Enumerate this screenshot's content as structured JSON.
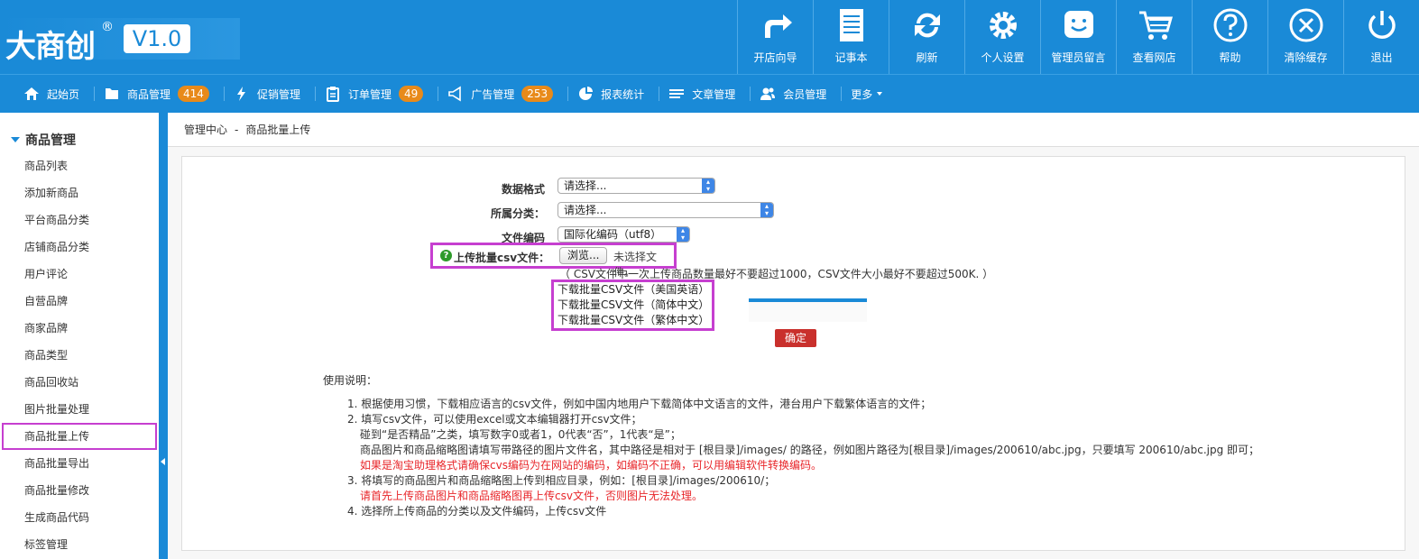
{
  "header": {
    "logo_text": "大商创",
    "logo_reg": "®",
    "version": "V1.0",
    "tools": [
      {
        "label": "开店向导",
        "icon": "share-arrow-icon"
      },
      {
        "label": "记事本",
        "icon": "notepad-icon"
      },
      {
        "label": "刷新",
        "icon": "refresh-icon"
      },
      {
        "label": "个人设置",
        "icon": "gear-icon"
      },
      {
        "label": "管理员留言",
        "icon": "smiley-message-icon"
      },
      {
        "label": "查看网店",
        "icon": "shopping-cart-icon"
      },
      {
        "label": "帮助",
        "icon": "help-icon"
      },
      {
        "label": "清除缓存",
        "icon": "close-circle-icon"
      },
      {
        "label": "退出",
        "icon": "power-icon"
      }
    ]
  },
  "nav": {
    "items": [
      {
        "label": "起始页",
        "icon": "home-icon",
        "badge": ""
      },
      {
        "label": "商品管理",
        "icon": "folder-icon",
        "badge": "414"
      },
      {
        "label": "促销管理",
        "icon": "lightning-icon",
        "badge": ""
      },
      {
        "label": "订单管理",
        "icon": "clipboard-icon",
        "badge": "49"
      },
      {
        "label": "广告管理",
        "icon": "megaphone-icon",
        "badge": "253"
      },
      {
        "label": "报表统计",
        "icon": "pie-chart-icon",
        "badge": ""
      },
      {
        "label": "文章管理",
        "icon": "list-icon",
        "badge": ""
      },
      {
        "label": "会员管理",
        "icon": "users-icon",
        "badge": ""
      },
      {
        "label": "更多",
        "icon": "caret-down-icon",
        "badge": ""
      }
    ]
  },
  "sidebar": {
    "heading": "商品管理",
    "items": [
      {
        "label": "商品列表"
      },
      {
        "label": "添加新商品"
      },
      {
        "label": "平台商品分类"
      },
      {
        "label": "店铺商品分类"
      },
      {
        "label": "用户评论"
      },
      {
        "label": "自营品牌"
      },
      {
        "label": "商家品牌"
      },
      {
        "label": "商品类型"
      },
      {
        "label": "商品回收站"
      },
      {
        "label": "图片批量处理"
      },
      {
        "label": "商品批量上传"
      },
      {
        "label": "商品批量导出"
      },
      {
        "label": "商品批量修改"
      },
      {
        "label": "生成商品代码"
      },
      {
        "label": "标签管理"
      }
    ],
    "active_label": "商品批量上传"
  },
  "breadcrumb": {
    "root": "管理中心",
    "separator": "-",
    "current": "商品批量上传"
  },
  "form": {
    "data_format_label": "数据格式",
    "data_format_value": "请选择...",
    "category_label": "所属分类：",
    "category_value": "请选择...",
    "encoding_label": "文件编码",
    "encoding_value": "国际化编码（utf8）",
    "upload_label": "上传批量csv文件：",
    "browse_label": "浏览...",
    "no_file_label": "未选择文件。",
    "note": "（ CSV文件中一次上传商品数量最好不要超过1000，CSV文件大小最好不要超过500K. ）",
    "downloads": [
      {
        "label": "下载批量CSV文件（美国英语）"
      },
      {
        "label": "下载批量CSV文件（简体中文）"
      },
      {
        "label": "下载批量CSV文件（繁体中文）"
      }
    ],
    "submit_label": "确定"
  },
  "usage": {
    "title": "使用说明：",
    "line1": "1. 根据使用习惯，下载相应语言的csv文件，例如中国内地用户下载简体中文语言的文件，港台用户下载繁体语言的文件；",
    "line2": "2. 填写csv文件，可以使用excel或文本编辑器打开csv文件；",
    "line2a": "碰到“是否精品”之类，填写数字0或者1，0代表“否”，1代表“是”；",
    "line2b": "商品图片和商品缩略图请填写带路径的图片文件名，其中路径是相对于 [根目录]/images/ 的路径，例如图片路径为[根目录]/images/200610/abc.jpg，只要填写 200610/abc.jpg 即可；",
    "line2c": "如果是淘宝助理格式请确保cvs编码为在网站的编码，如编码不正确，可以用编辑软件转换编码。",
    "line3": "3. 将填写的商品图片和商品缩略图上传到相应目录，例如：[根目录]/images/200610/；",
    "line3a": "请首先上传商品图片和商品缩略图再上传csv文件，否则图片无法处理。",
    "line4": "4. 选择所上传商品的分类以及文件编码，上传csv文件"
  },
  "colors": {
    "primary": "#1a8ad7",
    "badge": "#e88a1a",
    "highlight": "#c63fd0",
    "danger": "#c9302c",
    "warning_text": "#e8262a"
  }
}
